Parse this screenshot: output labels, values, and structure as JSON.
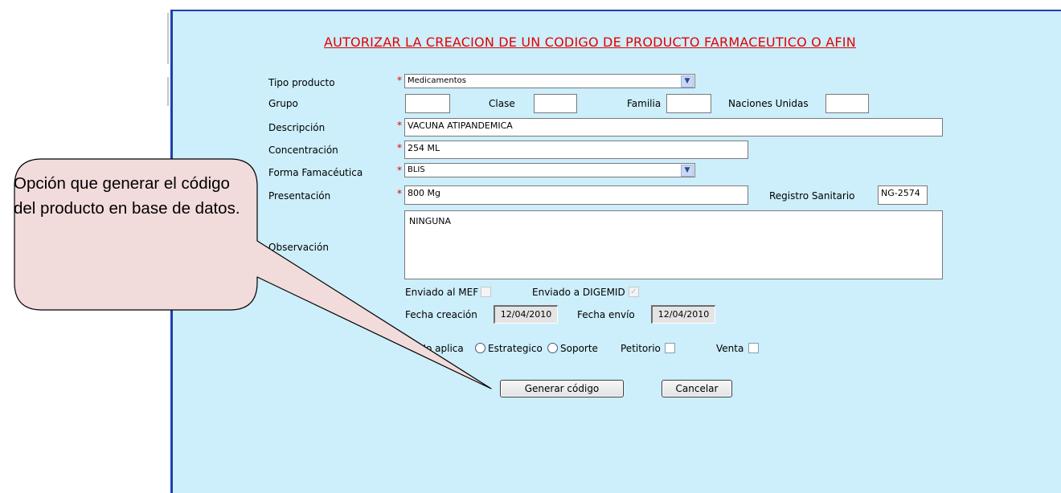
{
  "form": {
    "title": "AUTORIZAR LA CREACION DE UN CODIGO DE PRODUCTO FARMACEUTICO O AFIN",
    "required_mark": "*",
    "tipo_producto": {
      "label": "Tipo producto",
      "value": "Medicamentos"
    },
    "grupo": {
      "label": "Grupo",
      "value": ""
    },
    "clase": {
      "label": "Clase",
      "value": ""
    },
    "familia": {
      "label": "Familia",
      "value": ""
    },
    "naciones_unidas": {
      "label": "Naciones Unidas",
      "value": ""
    },
    "descripcion": {
      "label": "Descripción",
      "value": "VACUNA ATIPANDEMICA"
    },
    "concentracion": {
      "label": "Concentración",
      "value": "254 ML"
    },
    "forma_farmaceutica": {
      "label": "Forma Famacéutica",
      "value": "BLIS"
    },
    "presentacion": {
      "label": "Presentación",
      "value": "800 Mg"
    },
    "registro_sanitario": {
      "label": "Registro Sanitario",
      "value": "NG-2574"
    },
    "observacion": {
      "label": "Observación",
      "value": "NINGUNA"
    },
    "enviado_mef": {
      "label": "Enviado al MEF",
      "checked": false
    },
    "enviado_digemid": {
      "label": "Enviado a DIGEMID",
      "checked": true
    },
    "fecha_creacion": {
      "label": "Fecha creación",
      "value": "12/04/2010"
    },
    "fecha_envio": {
      "label": "Fecha envío",
      "value": "12/04/2010"
    },
    "radios": [
      {
        "label": "No aplica",
        "selected": false
      },
      {
        "label": "Estrategico",
        "selected": false
      },
      {
        "label": "Soporte",
        "selected": false
      }
    ],
    "petitorio": {
      "label": "Petitorio",
      "checked": false
    },
    "venta": {
      "label": "Venta",
      "checked": false
    },
    "buttons": {
      "generate": "Generar código",
      "cancel": "Cancelar"
    }
  },
  "callout": {
    "text": "Opción que generar el código del producto en base de datos.",
    "fill": "#f2dbdb"
  },
  "colors": {
    "panel_bg": "#cdeefb",
    "panel_border": "#1f3fae",
    "title": "#e20000",
    "required": "#e00000"
  }
}
